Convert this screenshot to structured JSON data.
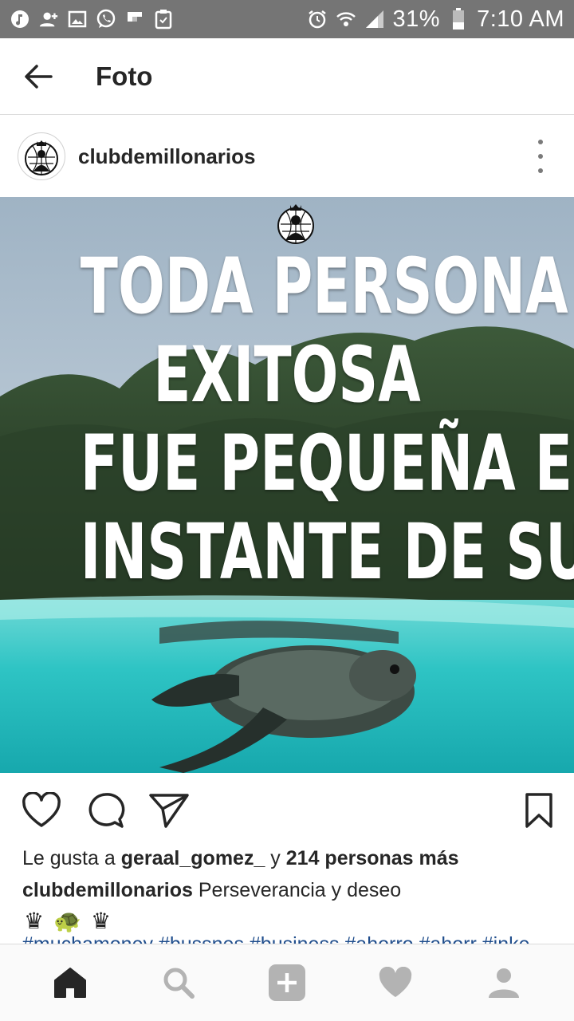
{
  "status_bar": {
    "battery": "31%",
    "time": "7:10 AM",
    "left_icons": [
      "music-icon",
      "add-contact-icon",
      "image-icon",
      "whatsapp-icon",
      "flipboard-icon",
      "clipboard-icon"
    ],
    "right_icons": [
      "alarm-icon",
      "wifi-icon",
      "signal-icon",
      "battery-icon"
    ]
  },
  "app_bar": {
    "title": "Foto"
  },
  "post": {
    "username": "clubdemillonarios",
    "image_text": [
      "TODA PERSONA",
      "EXITOSA",
      "FUE PEQUEÑA EN UN",
      "INSTANTE DE SU VIDA"
    ],
    "likes": {
      "prefix": "Le gusta a ",
      "user": "geraal_gomez_",
      "middle": " y ",
      "count": "214 personas más"
    },
    "caption": {
      "user": "clubdemillonarios",
      "text": " Perseverancia y deseo"
    },
    "emojis": [
      "♛",
      "🐢",
      "♛"
    ],
    "hashtags": "#muchamoney #bussnes #business #ahorro #ahorr #inke"
  },
  "colors": {
    "status_bar": "#757575",
    "sea": "#2ec4c4",
    "link": "#1f4d8c"
  }
}
